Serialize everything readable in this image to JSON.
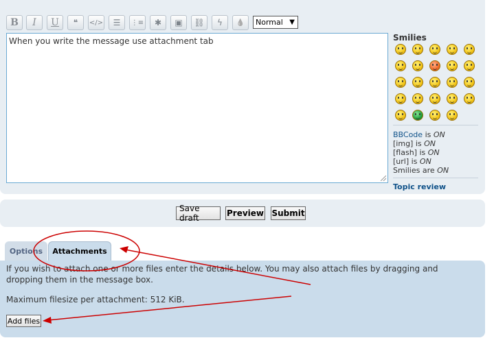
{
  "toolbar": {
    "buttons": [
      {
        "name": "bold-button",
        "label": "B"
      },
      {
        "name": "italic-button",
        "label": "I"
      },
      {
        "name": "underline-button",
        "label": "U"
      },
      {
        "name": "quote-button",
        "label": "❝"
      },
      {
        "name": "code-button",
        "label": "</>"
      },
      {
        "name": "list-button",
        "label": "☰"
      },
      {
        "name": "ordered-list-button",
        "label": "⋮≡"
      },
      {
        "name": "list-item-button",
        "label": "✱"
      },
      {
        "name": "image-button",
        "label": "▣"
      },
      {
        "name": "url-button",
        "label": "⛓"
      },
      {
        "name": "flash-button",
        "label": "ϟ"
      },
      {
        "name": "color-button",
        "label": "💧"
      }
    ],
    "font_size_select": "Normal"
  },
  "message": {
    "text": "When you write the message use attachment tab"
  },
  "smilies": {
    "title": "Smilies",
    "count": 24
  },
  "status": {
    "bbcode_label": "BBCode",
    "bbcode_is": "is",
    "bbcode_state": "ON",
    "img_label": "[img] is",
    "img_state": "ON",
    "flash_label": "[flash] is",
    "flash_state": "ON",
    "url_label": "[url] is",
    "url_state": "ON",
    "smilies_label": "Smilies are",
    "smilies_state": "ON",
    "topic_review": "Topic review"
  },
  "actions": {
    "save_draft": "Save draft",
    "preview": "Preview",
    "submit": "Submit"
  },
  "tabs": {
    "options": "Options",
    "attachments": "Attachments"
  },
  "attachments": {
    "intro_line1": "If you wish to attach one or more files enter the details below. You may also attach files by dragging and",
    "intro_line2": "dropping them in the message box.",
    "max_filesize": "Maximum filesize per attachment: 512 KiB.",
    "add_files": "Add files"
  },
  "colors": {
    "annotation_red": "#cc0000",
    "link_blue": "#105289",
    "panel_bg": "#e8eef3",
    "attachment_bg": "#cadceb"
  }
}
